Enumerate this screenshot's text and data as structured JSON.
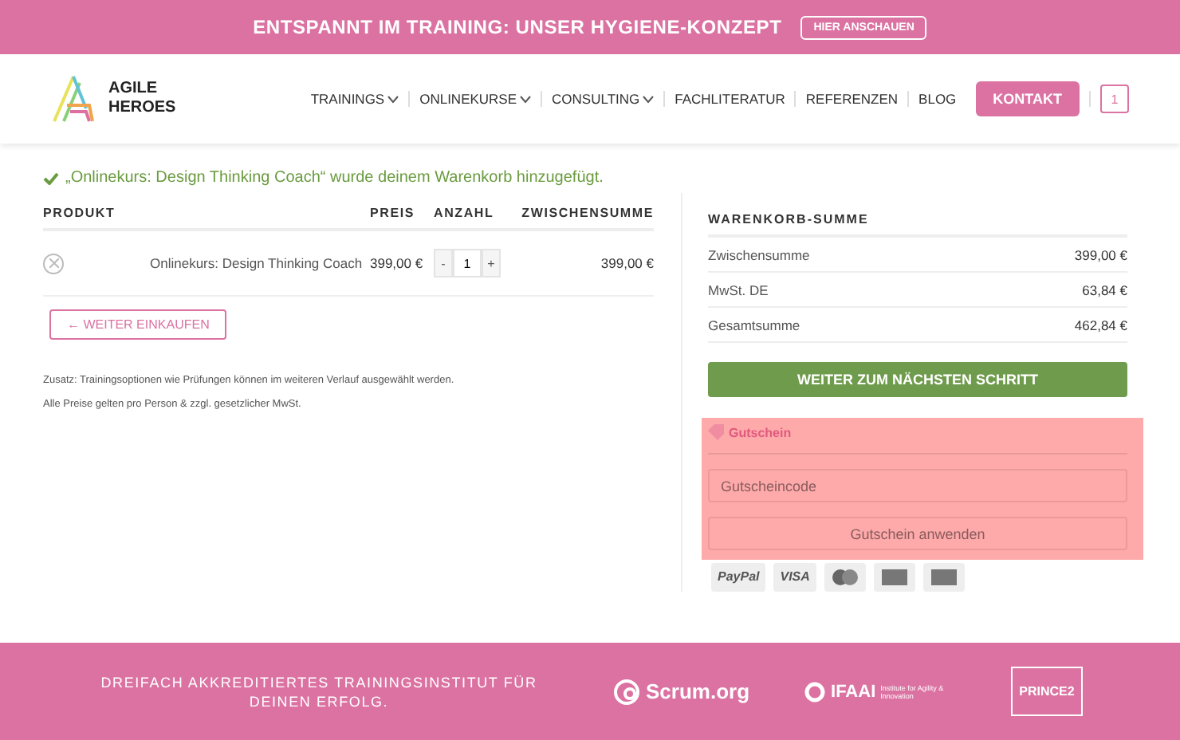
{
  "promo_bar": {
    "text": "ENTSPANNT IM TRAINING: UNSER HYGIENE-KONZEPT",
    "button": "HIER ANSCHAUEN"
  },
  "header": {
    "logo_text": [
      "AGILE",
      "HEROES"
    ],
    "nav": [
      {
        "label": "TRAININGS",
        "dropdown": true
      },
      {
        "label": "ONLINEKURSE",
        "dropdown": true
      },
      {
        "label": "CONSULTING",
        "dropdown": true
      },
      {
        "label": "FACHLITERATUR",
        "dropdown": false
      },
      {
        "label": "REFERENZEN",
        "dropdown": false
      },
      {
        "label": "BLOG",
        "dropdown": false
      }
    ],
    "contact_button": "KONTAKT",
    "cart_count": "1"
  },
  "notice": "„Onlinekurs: Design Thinking Coach“ wurde deinem Warenkorb hinzugefügt.",
  "cart_table": {
    "columns": [
      "PRODUKT",
      "PREIS",
      "ANZAHL",
      "ZWISCHENSUMME"
    ],
    "rows": [
      {
        "product": "Onlinekurs: Design Thinking Coach",
        "price": "399,00 €",
        "quantity": "1",
        "minus": "-",
        "plus": "+",
        "subtotal": "399,00 €"
      }
    ]
  },
  "continue_button": "← WEITER EINKAUFEN",
  "notes": [
    "Zusatz: Trainingsoptionen wie Prüfungen können im weiteren Verlauf ausgewählt werden.",
    "Alle Preise gelten pro Person & zzgl. gesetzlicher MwSt."
  ],
  "totals": {
    "title": "WARENKORB-SUMME",
    "rows": [
      {
        "label": "Zwischensumme",
        "value": "399,00 €"
      },
      {
        "label": "MwSt. DE",
        "value": "63,84 €"
      },
      {
        "label": "Gesamtsumme",
        "value": "462,84 €"
      }
    ],
    "checkout_button": "WEITER ZUM NÄCHSTEN SCHRITT"
  },
  "coupon": {
    "title": "Gutschein",
    "placeholder": "Gutscheincode",
    "button": "Gutschein anwenden"
  },
  "payment_methods": [
    {
      "kind": "text",
      "label": "PayPal"
    },
    {
      "kind": "text",
      "label": "VISA"
    },
    {
      "kind": "circles"
    },
    {
      "kind": "card"
    },
    {
      "kind": "card"
    }
  ],
  "footer": {
    "text": "DREIFACH AKKREDITIERTES TRAININGSINSTITUT FÜR DEINEN ERFOLG.",
    "scrum": "Scrum.org",
    "ifaai": "IFAAI",
    "ifaai_sub": "Institute for Agility & Innovation",
    "prince": "PRINCE2"
  }
}
